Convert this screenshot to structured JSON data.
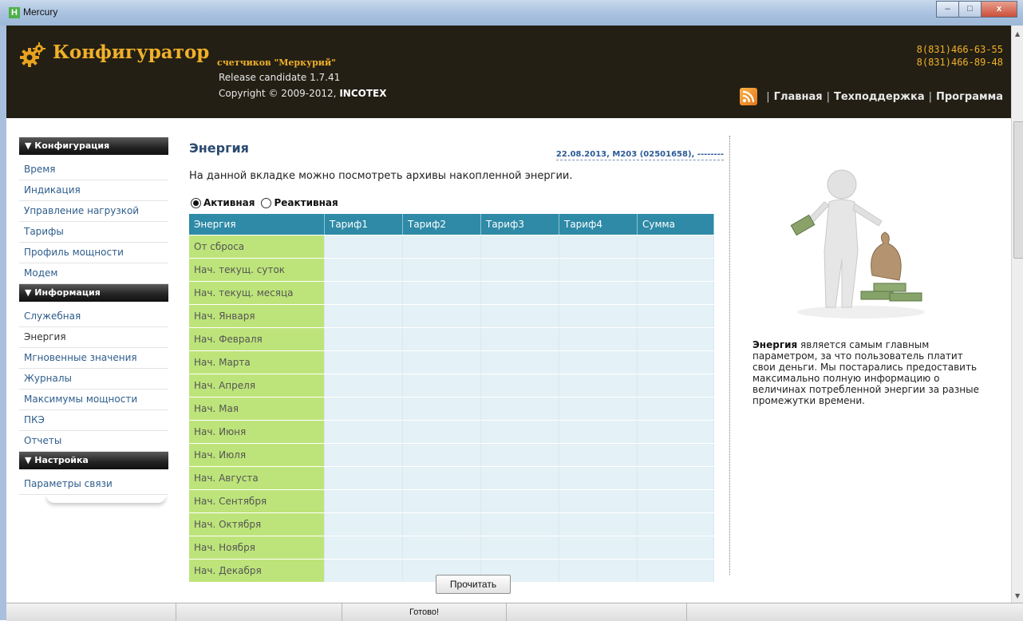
{
  "window": {
    "title": "Mercury",
    "app_icon": "H",
    "buttons": [
      "minimize",
      "maximize",
      "close"
    ],
    "close_label": "x"
  },
  "header": {
    "title": "Конфигуратор",
    "subtitle": "счетчиков \"Меркурий\"",
    "release": "Release candidate 1.7.41",
    "copyright_prefix": "Copyright © 2009-2012,",
    "copyright_company": "INCOTEX",
    "phones": [
      "8(831)466-63-55",
      "8(831)466-89-48"
    ],
    "nav": [
      "Главная",
      "Техподдержка",
      "Программа"
    ],
    "nav_separator": "|"
  },
  "sidebar": {
    "sections": [
      {
        "title": "▼ Конфигурация",
        "items": [
          "Время",
          "Индикация",
          "Управление нагрузкой",
          "Тарифы",
          "Профиль мощности",
          "Модем"
        ]
      },
      {
        "title": "▼ Информация",
        "items": [
          "Служебная",
          "Энергия",
          "Мгновенные значения",
          "Журналы",
          "Максимумы мощности",
          "ПКЭ",
          "Отчеты"
        ]
      },
      {
        "title": "▼ Настройка",
        "items": [
          "Параметры связи"
        ]
      }
    ],
    "active_item": "Энергия"
  },
  "main": {
    "title": "Энергия",
    "meta": "22.08.2013, M203 (02501658), --------",
    "description": "На данной вкладке можно посмотреть архивы накопленной энергии.",
    "radios": [
      {
        "label": "Активная",
        "checked": true
      },
      {
        "label": "Реактивная",
        "checked": false
      }
    ],
    "table": {
      "columns": [
        "Энергия",
        "Тариф1",
        "Тариф2",
        "Тариф3",
        "Тариф4",
        "Сумма"
      ],
      "rows": [
        "От сброса",
        "Нач. текущ. суток",
        "Нач. текущ. месяца",
        "Нач. Января",
        "Нач. Февраля",
        "Нач. Марта",
        "Нач. Апреля",
        "Нач. Мая",
        "Нач. Июня",
        "Нач. Июля",
        "Нач. Августа",
        "Нач. Сентября",
        "Нач. Октября",
        "Нач. Ноября",
        "Нач. Декабря"
      ]
    },
    "read_button": "Прочитать"
  },
  "right": {
    "text_bold": "Энергия",
    "text_rest": " является самым главным параметром, за что пользователь платит свои деньги. Мы постарались предоставить максимально полную информацию о величинах потребленной энергии за разные промежутки времени."
  },
  "statusbar": {
    "text": "Готово!"
  },
  "colors": {
    "header_bg": "#231f14",
    "accent_gold": "#f0b02a",
    "table_header": "#2e8aa6",
    "row_label_bg": "#bde47a",
    "cell_bg": "#e4f1f6",
    "link": "#2e5d8c"
  },
  "icons": [
    "gear-icon",
    "rss-icon",
    "illustration-man-money"
  ]
}
